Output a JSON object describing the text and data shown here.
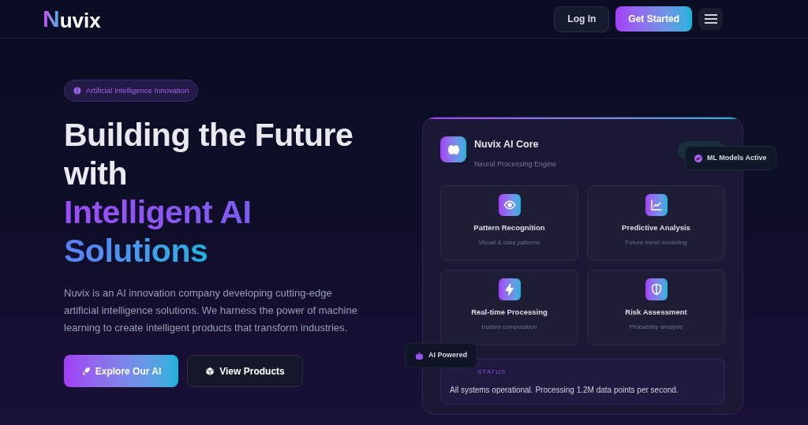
{
  "header": {
    "logo_letter": "N",
    "logo_rest": "uvix",
    "login": "Log In",
    "cta": "Get Started"
  },
  "hero": {
    "badge": "Artificial Intelligence Innovation",
    "title_lines": [
      {
        "text": "Building the Future",
        "kind": "plain"
      },
      {
        "text": "with",
        "kind": "plain"
      },
      {
        "text": "Intelligent AI",
        "kind": "purple"
      },
      {
        "text": "Solutions",
        "kind": "blue"
      }
    ],
    "description": "Nuvix is an AI innovation company developing cutting-edge artificial intelligence solutions. We harness the power of machine learning to create intelligent products that transform industries.",
    "buttons": [
      {
        "label": "Explore Our AI",
        "kind": "primary"
      },
      {
        "label": "View Products",
        "kind": "secondary"
      }
    ]
  },
  "core_card": {
    "title": "Nuvix AI Core",
    "subtitle": "Neural Processing Engine",
    "floating_badge": "ML Models Active",
    "features": [
      {
        "title": "Pattern Recognition",
        "subtitle": "Visual & data patterns",
        "kind": "eye"
      },
      {
        "title": "Predictive Analysis",
        "subtitle": "Future trend modeling",
        "kind": "chart"
      },
      {
        "title": "Real-time Processing",
        "subtitle": "Instant computation",
        "kind": "bolt"
      },
      {
        "title": "Risk Assessment",
        "subtitle": "Probability analysis",
        "kind": "shield"
      }
    ],
    "status_label": "STATUS",
    "status_text": "All systems operational. Processing 1.2M data points per second.",
    "side_badge": "AI Powered"
  }
}
